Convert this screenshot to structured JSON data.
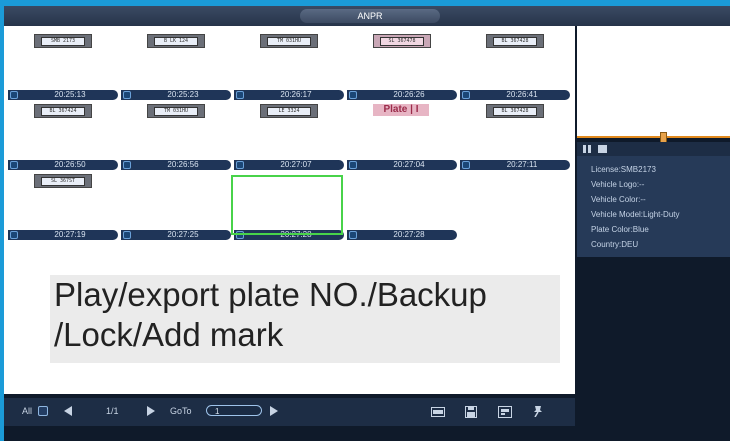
{
  "window": {
    "title": "ANPR"
  },
  "thumbnails": [
    {
      "time": "20:25:13",
      "plate": "SMB 2173",
      "style": "normal"
    },
    {
      "time": "20:25:23",
      "plate": "B LK 124",
      "style": "normal"
    },
    {
      "time": "20:26:17",
      "plate": "TM 031HU",
      "style": "normal"
    },
    {
      "time": "20:26:26",
      "plate": "SL 367478",
      "style": "pink"
    },
    {
      "time": "20:26:41",
      "plate": "BL 367428",
      "style": "normal"
    },
    {
      "time": "20:26:50",
      "plate": "BL 367424",
      "style": "normal"
    },
    {
      "time": "20:26:56",
      "plate": "TM 031HU",
      "style": "normal"
    },
    {
      "time": "20:27:07",
      "plate": "LE 3324",
      "style": "normal"
    },
    {
      "time": "20:27:04",
      "plate": "Plate | I",
      "style": "big"
    },
    {
      "time": "20:27:11",
      "plate": "BL 367428",
      "style": "normal"
    },
    {
      "time": "20:27:19",
      "plate": "SL 367ST",
      "style": "normal"
    },
    {
      "time": "20:27:25",
      "plate": "",
      "style": "empty"
    },
    {
      "time": "20:27:28",
      "plate": "",
      "style": "selected"
    },
    {
      "time": "20:27:28",
      "plate": "",
      "style": "empty"
    }
  ],
  "caption": {
    "line1": "Play/export plate  NO./Backup",
    "line2": "/Lock/Add mark"
  },
  "bottombar": {
    "all_label": "All",
    "page": "1/1",
    "goto_label": "GoTo",
    "goto_value": "1"
  },
  "preview": {
    "progress": 0.55
  },
  "info": {
    "license": "License:SMB2173",
    "logo": "Vehicle Logo:--",
    "color": "Vehicle Color:--",
    "model": "Vehicle Model:Light-Duty",
    "plate_color": "Plate Color:Blue",
    "country": "Country:DEU"
  },
  "colors": {
    "accent": "#1b9bd8",
    "selection": "#48d34a",
    "progress": "#e28a1e"
  },
  "icons": [
    "pause-icon",
    "stop-icon",
    "prev-page-icon",
    "next-page-icon",
    "go-icon",
    "export-icon",
    "backup-icon",
    "lock-icon",
    "mark-icon"
  ]
}
